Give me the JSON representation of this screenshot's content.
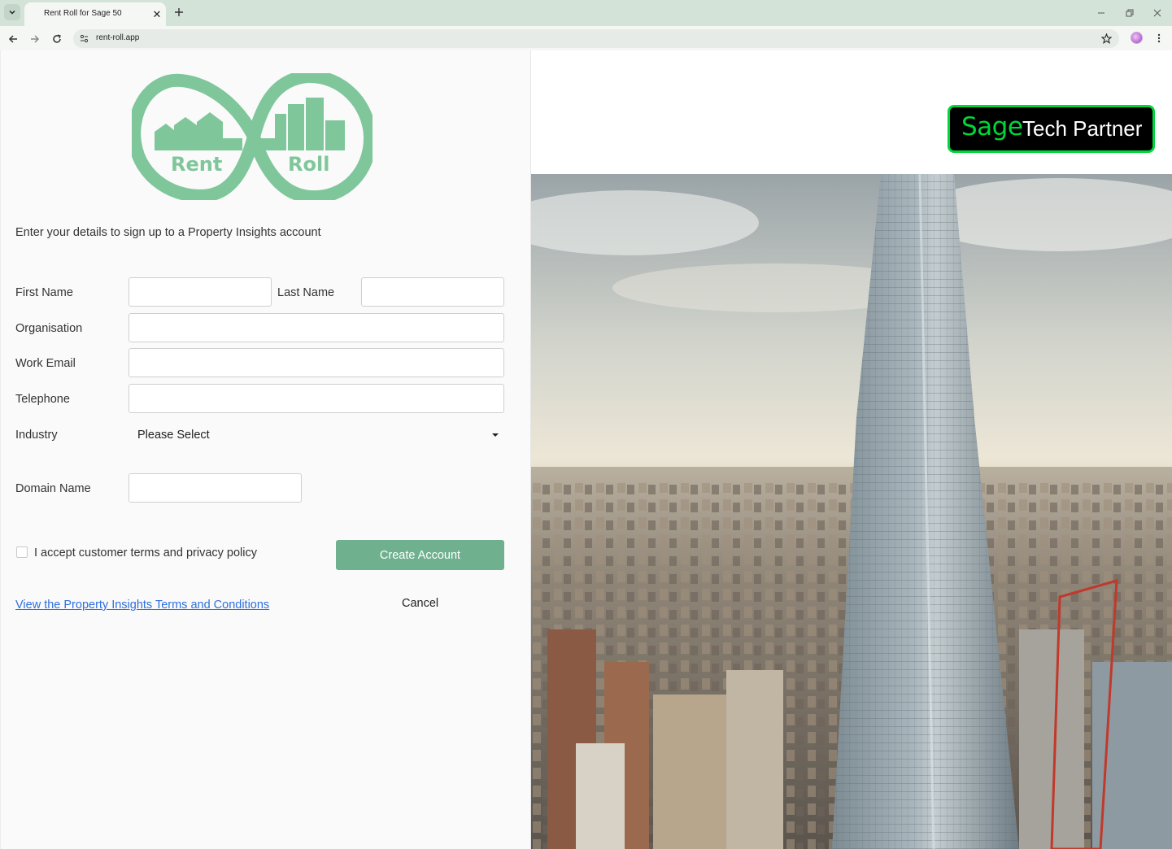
{
  "browser": {
    "tab_title": "Rent Roll for Sage 50",
    "url": "rent-roll.app"
  },
  "logo": {
    "word1": "Rent",
    "word2": "Roll"
  },
  "form": {
    "intro": "Enter your details to sign up to a Property Insights account",
    "first_name_label": "First Name",
    "last_name_label": "Last Name",
    "organisation_label": "Organisation",
    "work_email_label": "Work Email",
    "telephone_label": "Telephone",
    "industry_label": "Industry",
    "industry_selected": "Please Select",
    "domain_label": "Domain Name",
    "first_name_value": "",
    "last_name_value": "",
    "organisation_value": "",
    "work_email_value": "",
    "telephone_value": "",
    "domain_value": "",
    "accept_label": "I accept customer terms and privacy policy",
    "create_button": "Create Account",
    "terms_link": "View the Property Insights Terms and Conditions",
    "cancel_button": "Cancel"
  },
  "badge": {
    "brand": "Sage",
    "text": "Tech Partner"
  },
  "colors": {
    "accent_green": "#6fb08e",
    "logo_green": "#7fc79a",
    "sage_green": "#00d639",
    "link_blue": "#2f6fde"
  }
}
